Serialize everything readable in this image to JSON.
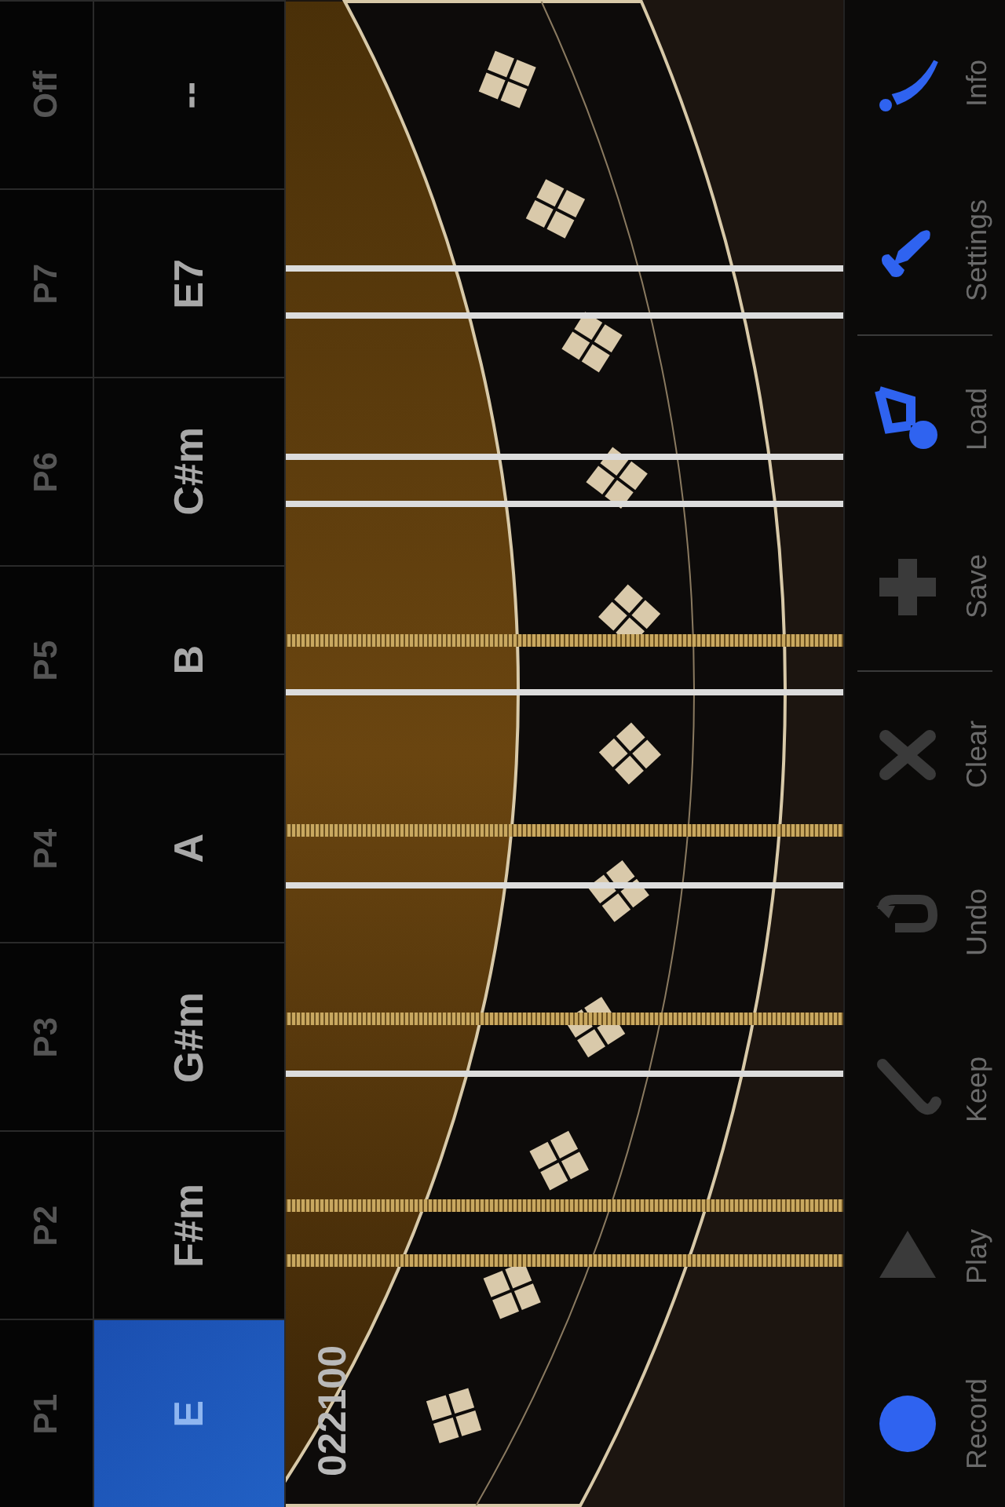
{
  "presets": [
    {
      "label": "P1",
      "chord": "E",
      "selected": true
    },
    {
      "label": "P2",
      "chord": "F#m",
      "selected": false
    },
    {
      "label": "P3",
      "chord": "G#m",
      "selected": false
    },
    {
      "label": "P4",
      "chord": "A",
      "selected": false
    },
    {
      "label": "P5",
      "chord": "B",
      "selected": false
    },
    {
      "label": "P6",
      "chord": "C#m",
      "selected": false
    },
    {
      "label": "P7",
      "chord": "E7",
      "selected": false
    },
    {
      "label": "Off",
      "chord": "--",
      "selected": false
    }
  ],
  "fingering": "022100",
  "strings": [
    {
      "kind": "plain"
    },
    {
      "kind": "plain"
    },
    {
      "kind": "plain"
    },
    {
      "kind": "plain"
    },
    {
      "kind": "wound"
    },
    {
      "kind": "plain"
    },
    {
      "kind": "wound"
    },
    {
      "kind": "plain"
    },
    {
      "kind": "wound"
    },
    {
      "kind": "plain"
    },
    {
      "kind": "wound"
    },
    {
      "kind": "wound"
    }
  ],
  "toolbar": [
    {
      "kind": "info",
      "label": "Info",
      "disabled": false,
      "separator_after": false
    },
    {
      "kind": "settings",
      "label": "Settings",
      "disabled": false,
      "separator_after": true
    },
    {
      "kind": "load",
      "label": "Load",
      "disabled": false,
      "separator_after": false
    },
    {
      "kind": "save",
      "label": "Save",
      "disabled": true,
      "separator_after": true
    },
    {
      "kind": "clear",
      "label": "Clear",
      "disabled": true,
      "separator_after": false
    },
    {
      "kind": "undo",
      "label": "Undo",
      "disabled": true,
      "separator_after": false
    },
    {
      "kind": "keep",
      "label": "Keep",
      "disabled": true,
      "separator_after": false
    },
    {
      "kind": "play",
      "label": "Play",
      "disabled": true,
      "separator_after": false
    },
    {
      "kind": "record",
      "label": "Record",
      "disabled": false,
      "separator_after": false
    }
  ]
}
